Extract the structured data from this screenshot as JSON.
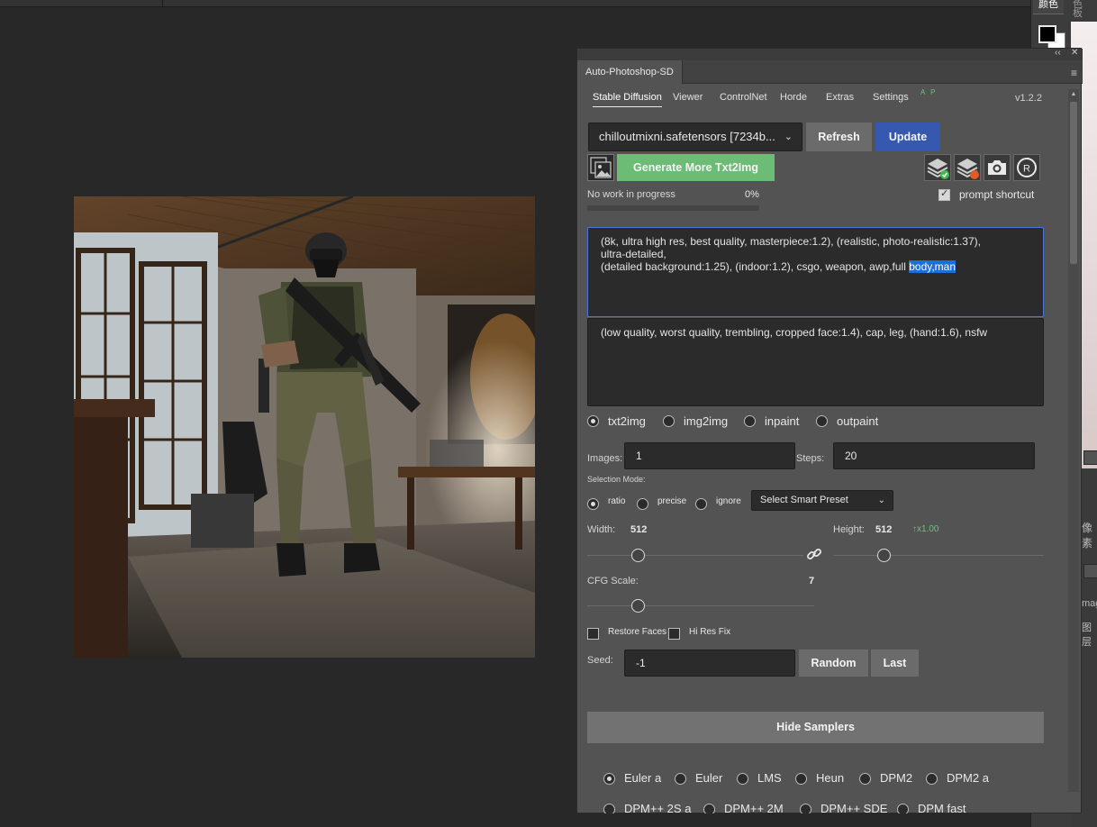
{
  "host": {
    "right_tabs": [
      "颜色",
      "色板"
    ],
    "right_labels": [
      "像素",
      "mag",
      "图层"
    ]
  },
  "panel": {
    "title": "Auto-Photoshop-SD",
    "tabs": [
      "Stable Diffusion",
      "Viewer",
      "ControlNet",
      "Horde",
      "Extras",
      "Settings"
    ],
    "tab_badge": "A P",
    "version": "v1.2.2",
    "model": "chilloutmixni.safetensors [7234b...",
    "refresh_label": "Refresh",
    "update_label": "Update",
    "generate_label": "Generate More Txt2Img",
    "progress_text": "No work in progress",
    "progress_percent": "0%",
    "progress_value": 0,
    "prompt_shortcut_label": "prompt shortcut",
    "prompt_shortcut_checked": true,
    "prompt_line1": "(8k, ultra high res, best quality, masterpiece:1.2), (realistic, photo-realistic:1.37),",
    "prompt_line2": "ultra-detailed,",
    "prompt_line3_pre": "(detailed background:1.25), (indoor:1.2), csgo, weapon, awp,full ",
    "prompt_line3_sel": "body,man",
    "negative_prompt": "(low quality, worst quality, trembling, cropped face:1.4), cap, leg, (hand:1.6), nsfw",
    "modes": [
      "txt2img",
      "img2img",
      "inpaint",
      "outpaint"
    ],
    "mode_selected": "txt2img",
    "images_label": "Images:",
    "images_value": "1",
    "steps_label": "Steps:",
    "steps_value": "20",
    "selection_mode_label": "Selection Mode:",
    "selection_modes": [
      "ratio",
      "precise",
      "ignore"
    ],
    "selection_mode_selected": "ratio",
    "smart_preset": "Select Smart Preset",
    "width_label": "Width:",
    "width_value": "512",
    "height_label": "Height:",
    "height_value": "512",
    "ratio_text": "↑x1.00",
    "cfg_label": "CFG Scale:",
    "cfg_value": "7",
    "restore_faces_label": "Restore Faces",
    "hires_fix_label": "Hi Res Fix",
    "seed_label": "Seed:",
    "seed_value": "-1",
    "random_label": "Random",
    "last_label": "Last",
    "hide_samplers_label": "Hide Samplers",
    "samplers_row1": [
      "Euler a",
      "Euler",
      "LMS",
      "Heun",
      "DPM2",
      "DPM2 a"
    ],
    "samplers_row2": [
      "DPM++ 2S a",
      "DPM++ 2M",
      "DPM++ SDE",
      "DPM fast"
    ],
    "sampler_selected": "Euler a"
  },
  "colors": {
    "accent_blue": "#3658ae",
    "accent_green": "#6cbc76",
    "panel_bg": "#535353",
    "canvas_bg": "#282828"
  }
}
